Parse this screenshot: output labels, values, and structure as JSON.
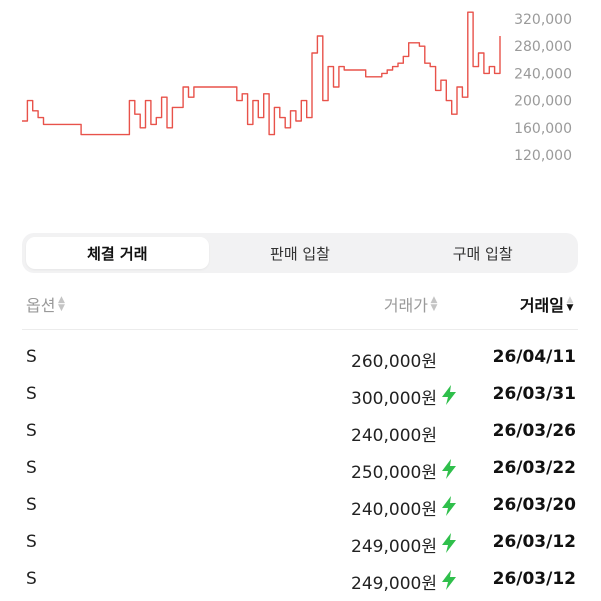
{
  "chart": {
    "color": "#e8524a",
    "y_tick_labels": [
      "320,000",
      "280,000",
      "240,000",
      "200,000",
      "160,000",
      "120,000"
    ],
    "y_ticks": [
      320000,
      280000,
      240000,
      200000,
      160000,
      120000
    ],
    "ylim": [
      120000,
      320000
    ],
    "series": [
      170000,
      200000,
      185000,
      175000,
      165000,
      165000,
      165000,
      165000,
      165000,
      165000,
      165000,
      150000,
      150000,
      150000,
      150000,
      150000,
      150000,
      150000,
      150000,
      150000,
      200000,
      180000,
      160000,
      200000,
      165000,
      175000,
      205000,
      160000,
      190000,
      190000,
      220000,
      205000,
      220000,
      220000,
      220000,
      220000,
      220000,
      220000,
      220000,
      220000,
      200000,
      210000,
      165000,
      200000,
      175000,
      210000,
      150000,
      190000,
      175000,
      160000,
      185000,
      170000,
      200000,
      175000,
      270000,
      295000,
      200000,
      250000,
      220000,
      250000,
      245000,
      245000,
      245000,
      245000,
      235000,
      235000,
      235000,
      240000,
      245000,
      250000,
      255000,
      265000,
      285000,
      285000,
      280000,
      255000,
      250000,
      215000,
      230000,
      200000,
      180000,
      220000,
      205000,
      330000,
      250000,
      270000,
      240000,
      250000,
      240000,
      295000
    ]
  },
  "tabs": [
    {
      "label": "체결 거래",
      "active": true
    },
    {
      "label": "판매 입찰",
      "active": false
    },
    {
      "label": "구매 입찰",
      "active": false
    }
  ],
  "table": {
    "headers": {
      "option": "옵션",
      "price": "거래가",
      "date": "거래일"
    },
    "rows": [
      {
        "option": "S",
        "price": "260,000원",
        "flash": false,
        "date": "26/04/11"
      },
      {
        "option": "S",
        "price": "300,000원",
        "flash": true,
        "date": "26/03/31"
      },
      {
        "option": "S",
        "price": "240,000원",
        "flash": false,
        "date": "26/03/26"
      },
      {
        "option": "S",
        "price": "250,000원",
        "flash": true,
        "date": "26/03/22"
      },
      {
        "option": "S",
        "price": "240,000원",
        "flash": true,
        "date": "26/03/20"
      },
      {
        "option": "S",
        "price": "249,000원",
        "flash": true,
        "date": "26/03/12"
      },
      {
        "option": "S",
        "price": "249,000원",
        "flash": true,
        "date": "26/03/12"
      }
    ]
  },
  "flash_color": "#2fbf4b"
}
